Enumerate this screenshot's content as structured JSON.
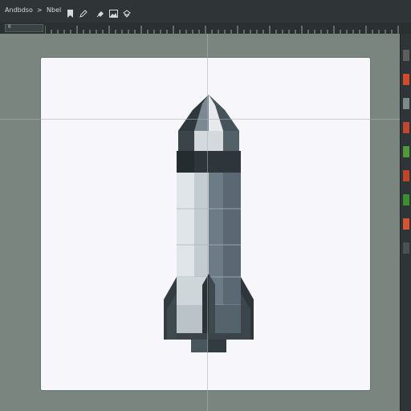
{
  "app": {
    "breadcrumb": [
      "Andbdso",
      ">"
    ],
    "mode_label": "Nbel"
  },
  "toolbar": {
    "icons": [
      "bookmark-icon",
      "pen-icon",
      "fill-icon",
      "image-icon",
      "layers-icon"
    ]
  },
  "coords": {
    "x": "0",
    "y": "0"
  },
  "swatches": [
    "#5c5f5c",
    "#d44a2c",
    "#7d8a88",
    "#c0482d",
    "#4e9a3a",
    "#c1452b",
    "#3b8f2e",
    "#d6542f",
    "#495152"
  ],
  "canvas": {
    "background": "#f7f7fb"
  },
  "rocket": {
    "colors": {
      "nose_dark": "#3a4449",
      "nose_light": "#e4e7ea",
      "band": "#2e363b",
      "body_light": "#dde3e6",
      "body_mid": "#9aa8b2",
      "body_dark": "#6a7984",
      "fin_dark": "#333b40",
      "fin_mid": "#55626b"
    }
  }
}
